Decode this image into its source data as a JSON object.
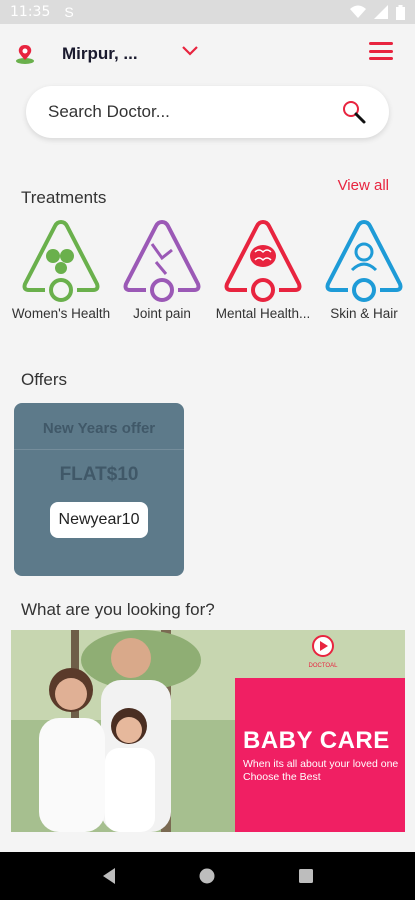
{
  "status_bar": {
    "time": "11:35",
    "sim_glyph": "S"
  },
  "header": {
    "location": "Mirpur, ...",
    "icon_pin": "location-pin-icon",
    "icon_menu": "hamburger-menu-icon"
  },
  "search": {
    "placeholder": "Search Doctor...",
    "icon": "search-icon"
  },
  "treatments": {
    "title": "Treatments",
    "view_all": "View all",
    "items": [
      {
        "label": "Women's Health",
        "color": "#6ab04c"
      },
      {
        "label": "Joint pain",
        "color": "#9b59b6"
      },
      {
        "label": "Mental Health...",
        "color": "#e8243f"
      },
      {
        "label": "Skin & Hair",
        "color": "#1e9bd7"
      }
    ]
  },
  "offers": {
    "title": "Offers",
    "card": {
      "title": "New Years offer",
      "amount": "FLAT$10",
      "code": "Newyear10"
    }
  },
  "looking_for": {
    "title": "What are you looking for?",
    "banner": {
      "heading": "BABY CARE",
      "subtext": "When its all about your loved one Choose the Best",
      "logo_text": "DOCTOAL"
    }
  },
  "colors": {
    "accent": "#e8243f",
    "offer_bg": "#5d7a8a",
    "banner_pink": "#f01f63"
  }
}
